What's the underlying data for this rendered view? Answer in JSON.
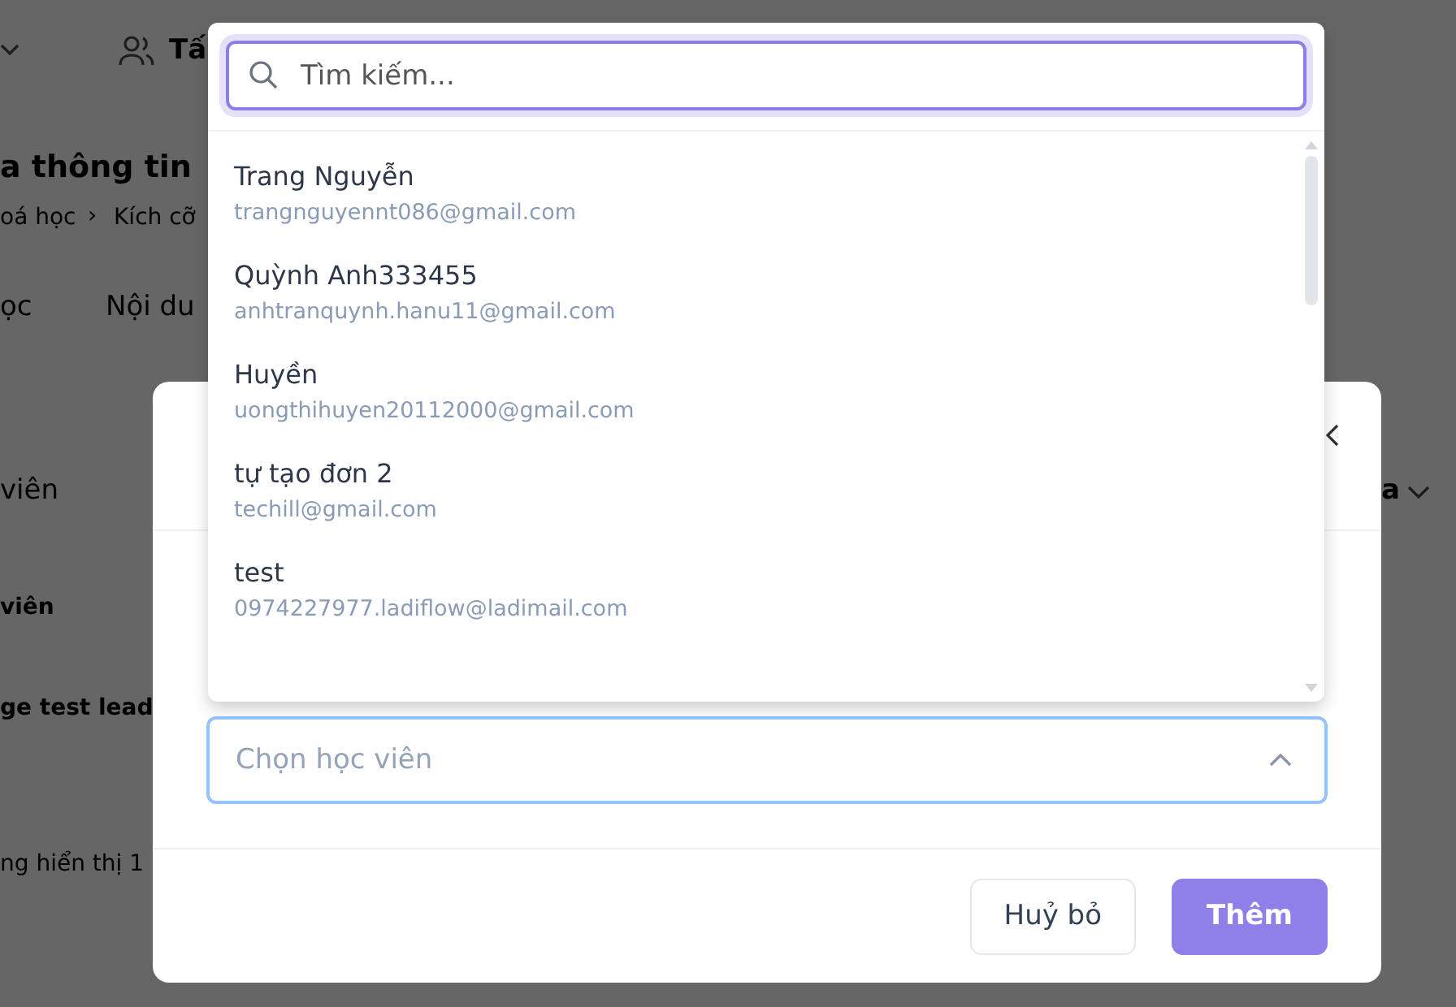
{
  "page": {
    "header_label": "Tấ",
    "title": "a thông tin",
    "breadcrumb": [
      "oá học",
      "Kích cỡ"
    ],
    "breadcrumb_separator": "›",
    "tabs": [
      "ọc",
      "Nội du"
    ],
    "section_label": "viên",
    "filter_label": "a",
    "column_header": "viên",
    "row_name": "ge test lead",
    "footer_text": "ng hiển thị 1"
  },
  "modal": {
    "select": {
      "placeholder": "Chọn học viên",
      "expanded": true
    },
    "buttons": [
      {
        "label": "Huỷ bỏ",
        "kind": "secondary"
      },
      {
        "label": "Thêm",
        "kind": "primary"
      }
    ]
  },
  "dropdown": {
    "search": {
      "placeholder": "Tìm kiếm..."
    },
    "options": [
      {
        "name": "Trang Nguyễn",
        "email": "trangnguyennt086@gmail.com"
      },
      {
        "name": "Quỳnh Anh333455",
        "email": "anhtranquynh.hanu11@gmail.com"
      },
      {
        "name": "Huyền",
        "email": "uongthihuyen20112000@gmail.com"
      },
      {
        "name": "tự tạo đơn 2",
        "email": "techill@gmail.com"
      },
      {
        "name": "test",
        "email": "0974227977.ladiflow@ladimail.com"
      }
    ]
  }
}
